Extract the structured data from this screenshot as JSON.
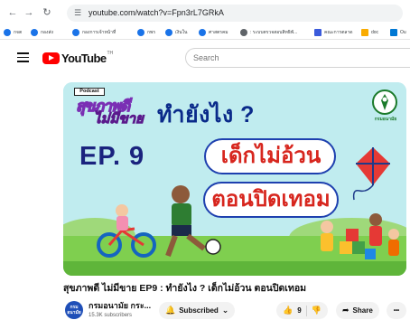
{
  "browser": {
    "url": "youtube.com/watch?v=Fpn3rL7GRkA",
    "bookmarks": [
      {
        "label": "กจต",
        "icon": "globe-icon",
        "color": "#1a73e8"
      },
      {
        "label": "กองส่ง",
        "icon": "globe-icon",
        "color": "#1a73e8"
      },
      {
        "label": "กองการเจ้าหน้าที่",
        "icon": "globe-icon",
        "color": "#1a73e8"
      },
      {
        "label": "กพร",
        "icon": "globe-icon",
        "color": "#1a73e8"
      },
      {
        "label": "เงินใน",
        "icon": "globe-icon",
        "color": "#1a73e8"
      },
      {
        "label": "ศาสตรคม",
        "icon": "globe-icon",
        "color": "#1a73e8"
      },
      {
        "label": ": ระบบตรวจสอบสิทธิพั...",
        "icon": "globe-icon",
        "color": "#5f6368"
      },
      {
        "label": "คณะการตลาด",
        "icon": "bookmark-square-icon",
        "color": "#3b5bdb"
      },
      {
        "label": "doc",
        "icon": "docs-icon",
        "color": "#f9ab00"
      },
      {
        "label": "Ou",
        "icon": "outlook-icon",
        "color": "#0078d4"
      }
    ]
  },
  "youtube": {
    "logo_text": "YouTube",
    "logo_suffix": "TH",
    "search_placeholder": "Search"
  },
  "thumbnail": {
    "podcast_tag": "Podcast",
    "show_logo_line1": "สุขภาพดี",
    "show_logo_line2": "ไม่มีขาย",
    "question": "ทำยังไง ?",
    "episode": "EP. 9",
    "headline_line1": "เด็กไม่อ้วน",
    "headline_line2": "ตอนปิดเทอม",
    "dept_name": "กรมอนามัย"
  },
  "video": {
    "title": "สุขภาพดี ไม่มีขาย EP9 : ทำยังไง ? เด็กไม่อ้วน ตอนปิดเทอม",
    "channel_name": "กรมอนามัย กระ...",
    "subscribers": "15.3K subscribers",
    "avatar_text": "กรมอนามัย",
    "subscribed_label": "Subscribed",
    "like_count": "9",
    "share_label": "Share",
    "more_label": "•••"
  }
}
